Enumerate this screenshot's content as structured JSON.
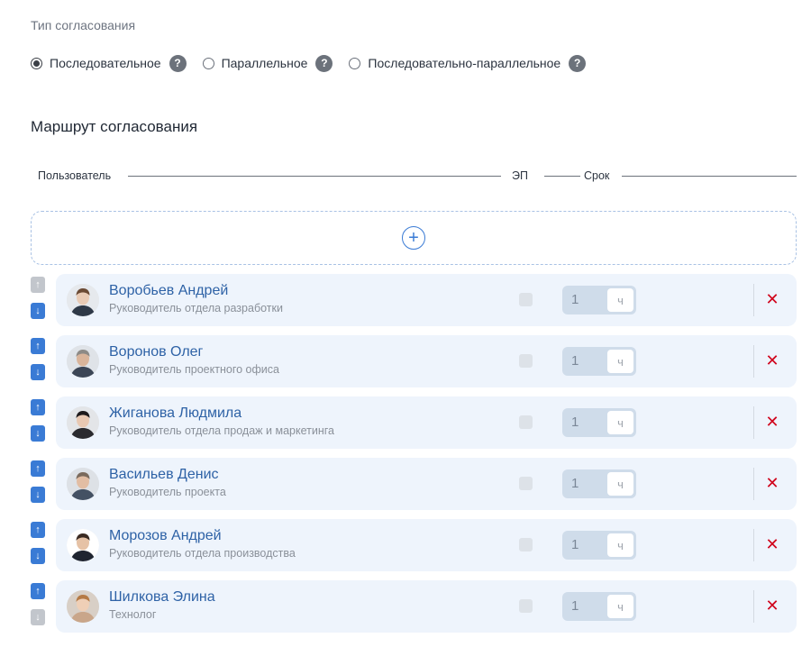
{
  "approval_type": {
    "label": "Тип согласования",
    "options": [
      {
        "label": "Последовательное",
        "checked": true
      },
      {
        "label": "Параллельное",
        "checked": false
      },
      {
        "label": "Последовательно-параллельное",
        "checked": false
      }
    ],
    "help_glyph": "?"
  },
  "route": {
    "title": "Маршрут согласования",
    "columns": {
      "user": "Пользователь",
      "ep": "ЭП",
      "term": "Срок"
    },
    "add_glyph": "+",
    "rows": [
      {
        "name": "Воробьев Андрей",
        "role": "Руководитель отдела разработки",
        "term": "1",
        "unit": "ч",
        "up_enabled": false,
        "down_enabled": true,
        "avatar": {
          "skin": "#e9cbb5",
          "hair": "#6b4a34",
          "cloth": "#2f3947",
          "bg": "#e6e9ed"
        }
      },
      {
        "name": "Воронов Олег",
        "role": "Руководитель проектного офиса",
        "term": "1",
        "unit": "ч",
        "up_enabled": true,
        "down_enabled": true,
        "avatar": {
          "skin": "#d9b49a",
          "hair": "#8d8a86",
          "cloth": "#3c4656",
          "bg": "#dfe3e8"
        }
      },
      {
        "name": "Жиганова Людмила",
        "role": "Руководитель отдела продаж и маркетинга",
        "term": "1",
        "unit": "ч",
        "up_enabled": true,
        "down_enabled": true,
        "avatar": {
          "skin": "#e8c8b2",
          "hair": "#1d1a1c",
          "cloth": "#2a2a2e",
          "bg": "#e3e5e8"
        }
      },
      {
        "name": "Васильев Денис",
        "role": "Руководитель проекта",
        "term": "1",
        "unit": "ч",
        "up_enabled": true,
        "down_enabled": true,
        "avatar": {
          "skin": "#e2bda3",
          "hair": "#7a6a5c",
          "cloth": "#445163",
          "bg": "#dde1e6"
        }
      },
      {
        "name": "Морозов Андрей",
        "role": "Руководитель отдела производства",
        "term": "1",
        "unit": "ч",
        "up_enabled": true,
        "down_enabled": true,
        "avatar": {
          "skin": "#e6c2a6",
          "hair": "#3a2a22",
          "cloth": "#1f2430",
          "bg": "#ffffff"
        }
      },
      {
        "name": "Шилкова Элина",
        "role": "Технолог",
        "term": "1",
        "unit": "ч",
        "up_enabled": true,
        "down_enabled": false,
        "avatar": {
          "skin": "#efcfb6",
          "hair": "#b57a45",
          "cloth": "#c9a68a",
          "bg": "#d8cfc6"
        }
      }
    ]
  },
  "icons": {
    "up": "arrow-up-icon",
    "down": "arrow-down-icon",
    "delete": "close-icon",
    "help": "question-circle-icon",
    "add": "plus-circle-icon"
  },
  "glyphs": {
    "up": "↑",
    "down": "↓",
    "delete": "✕"
  },
  "colors": {
    "accent": "#3a7bd5",
    "delete": "#d0021b",
    "name": "#2e62a6",
    "card": "#eef4fc"
  }
}
